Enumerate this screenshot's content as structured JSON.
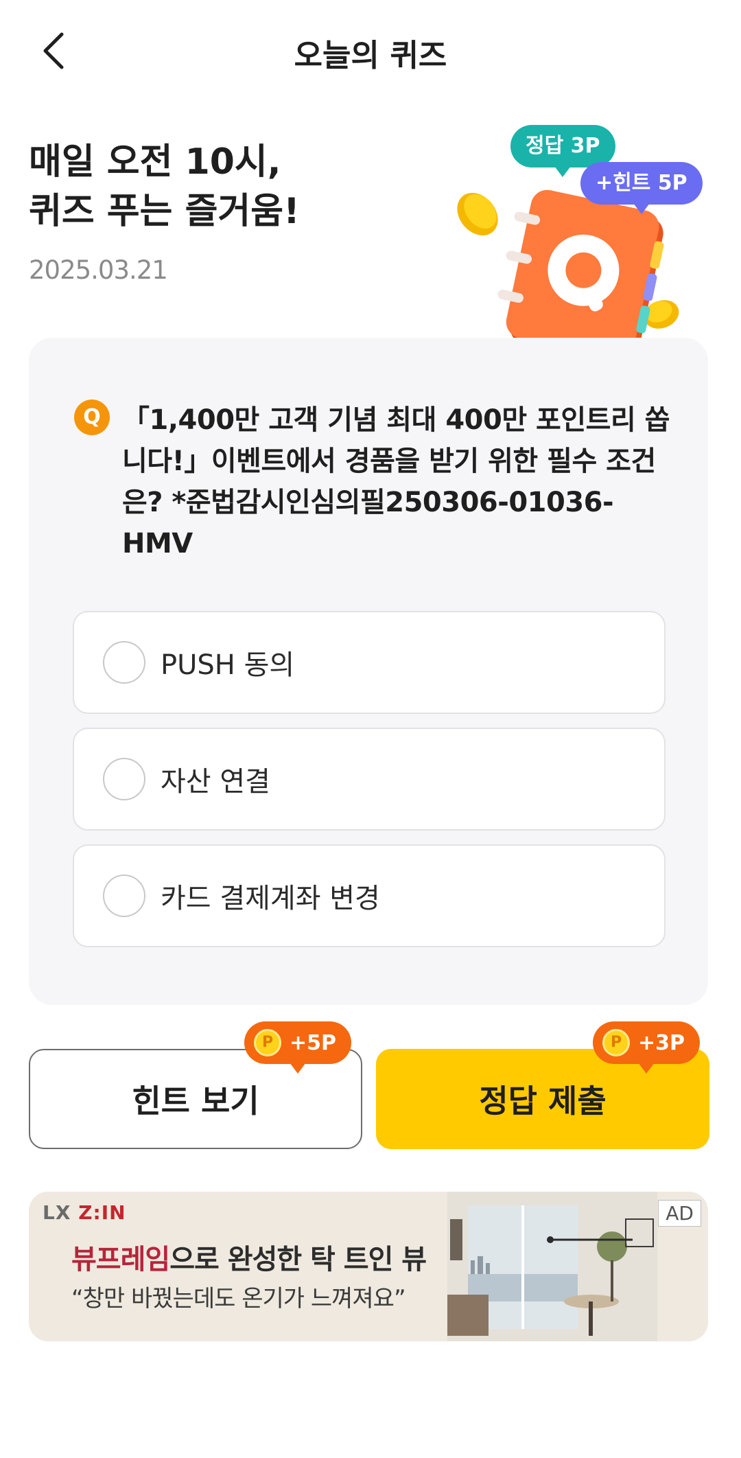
{
  "header": {
    "title": "오늘의 퀴즈",
    "back_icon": "chevron-left-icon"
  },
  "hero": {
    "title_line1": "매일 오전 10시,",
    "title_line2": "퀴즈 푸는 즐거움!",
    "date": "2025.03.21",
    "bubble_answer": "정답 3P",
    "bubble_hint": "+힌트 5P",
    "illustration_icon": "quiz-notebook-icon"
  },
  "quiz": {
    "badge": "Q",
    "question": "「1,400만 고객 기념 최대 400만 포인트리 쏩니다!」이벤트에서 경품을 받기 위한 필수 조건은? *준법감시인심의필250306-01036-HMV",
    "options": [
      {
        "label": "PUSH 동의",
        "selected": false
      },
      {
        "label": "자산 연결",
        "selected": false
      },
      {
        "label": "카드 결제계좌 변경",
        "selected": false
      }
    ]
  },
  "actions": {
    "hint_label": "힌트 보기",
    "hint_points": "+5P",
    "submit_label": "정답 제출",
    "submit_points": "+3P",
    "coin_symbol": "P"
  },
  "ad": {
    "brand_prefix": "LX",
    "brand_name": "Z:IN",
    "headline_accent": "뷰프레임",
    "headline_rest": "으로 완성한 탁 트인 뷰",
    "subtext": "“창만 바꿨는데도 온기가 느껴져요”",
    "tag": "AD"
  },
  "colors": {
    "accent_yellow": "#ffca00",
    "point_orange": "#f5680f",
    "q_badge_orange": "#f5950b",
    "bubble_teal": "#19b3aa",
    "bubble_purple": "#6a6cf2"
  }
}
